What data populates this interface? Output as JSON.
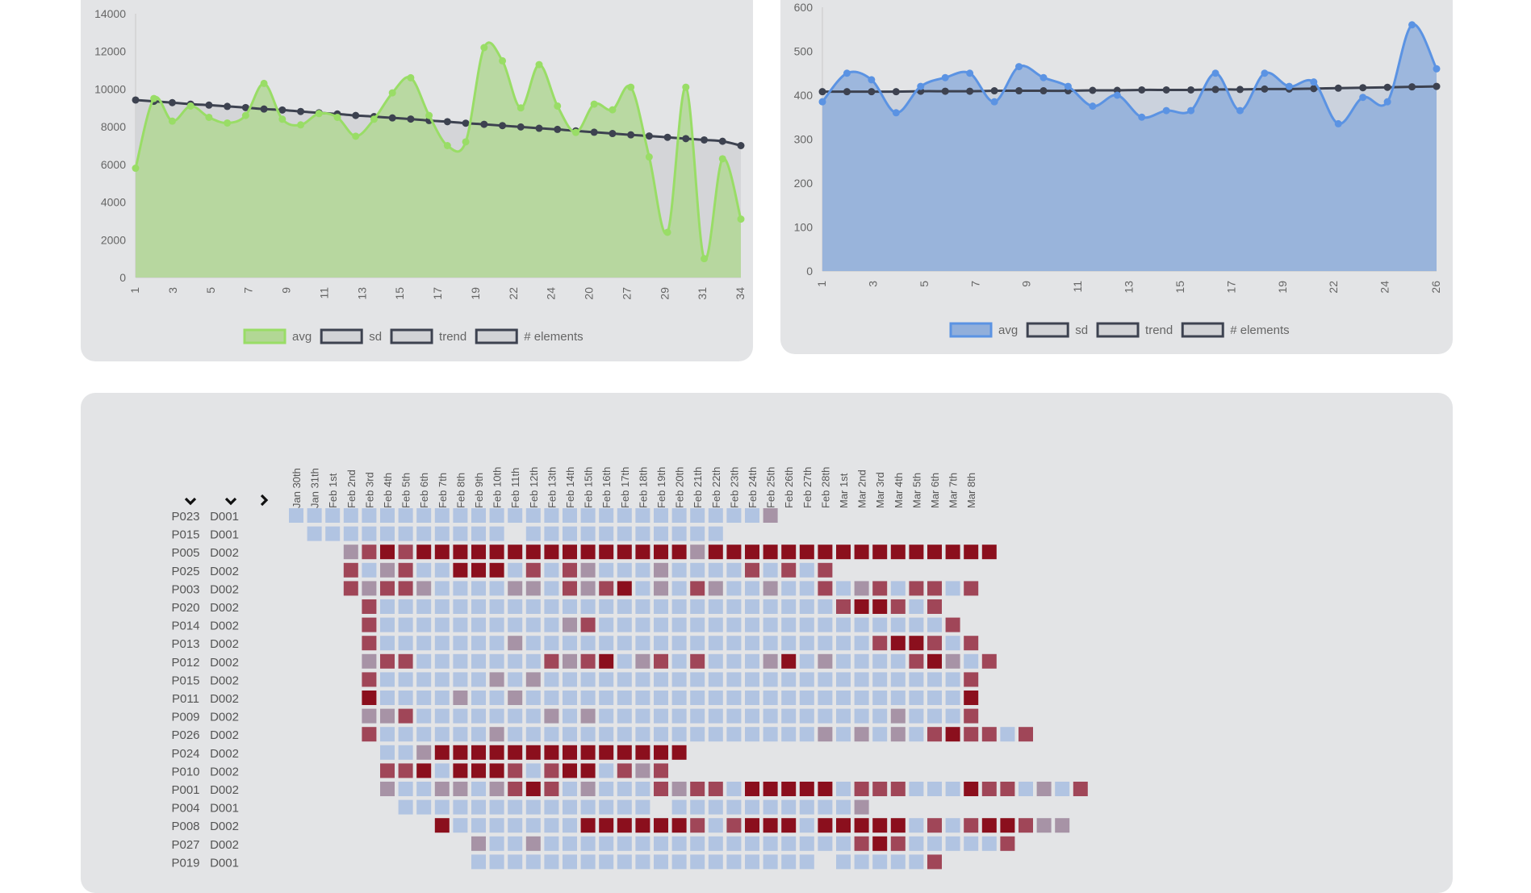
{
  "chart_data": [
    {
      "type": "line",
      "chart": "left",
      "x_ticks": [
        "1",
        "3",
        "5",
        "7",
        "9",
        "11",
        "13",
        "15",
        "17",
        "19",
        "22",
        "24",
        "20",
        "27",
        "29",
        "31",
        "34"
      ],
      "ylim": [
        0,
        14000
      ],
      "y_ticks": [
        "0",
        "2000",
        "4000",
        "6000",
        "8000",
        "10000",
        "12000",
        "14000"
      ],
      "series": [
        {
          "name": "avg",
          "values": [
            5800,
            9500,
            8300,
            9100,
            8500,
            8200,
            8600,
            10300,
            8400,
            8100,
            8700,
            8500,
            7500,
            8400,
            9800,
            10600,
            8600,
            7000,
            7200,
            12200,
            11500,
            9000,
            11300,
            9100,
            7700,
            9200,
            8900,
            10100,
            6400,
            2400,
            10100,
            1000,
            6300,
            3100
          ]
        },
        {
          "name": "sd",
          "values": [
            9420,
            9350,
            9280,
            9200,
            9150,
            9080,
            9020,
            8940,
            8890,
            8810,
            8740,
            8680,
            8600,
            8540,
            8470,
            8410,
            8330,
            8270,
            8190,
            8130,
            8060,
            7990,
            7920,
            7860,
            7780,
            7710,
            7640,
            7570,
            7510,
            7440,
            7370,
            7300,
            7230,
            7000
          ]
        }
      ],
      "legend": [
        "avg",
        "sd",
        "trend",
        "# elements"
      ],
      "colors": {
        "avg_line": "#99dd66",
        "avg_fill": "#b2d795",
        "sd_line": "#3d4250",
        "sd_fill": "#d2d3d6"
      },
      "grid": false
    },
    {
      "type": "line",
      "chart": "right",
      "x_ticks": [
        "1",
        "3",
        "5",
        "7",
        "9",
        "11",
        "13",
        "15",
        "17",
        "19",
        "22",
        "24",
        "26"
      ],
      "ylim": [
        0,
        600
      ],
      "y_ticks": [
        "0",
        "100",
        "200",
        "300",
        "400",
        "500",
        "600"
      ],
      "series": [
        {
          "name": "avg",
          "values": [
            385,
            450,
            435,
            360,
            420,
            440,
            450,
            385,
            465,
            440,
            420,
            375,
            400,
            350,
            365,
            365,
            450,
            365,
            450,
            420,
            430,
            335,
            395,
            385,
            560,
            460
          ]
        },
        {
          "name": "sd",
          "values": [
            408,
            408,
            408,
            408,
            409,
            409,
            409,
            410,
            410,
            410,
            410,
            411,
            411,
            412,
            412,
            412,
            413,
            413,
            414,
            414,
            415,
            416,
            417,
            418,
            419,
            420
          ]
        }
      ],
      "legend": [
        "avg",
        "sd",
        "trend",
        "# elements"
      ],
      "colors": {
        "avg_line": "#5b93e3",
        "avg_fill": "#91afdb",
        "sd_line": "#3d4250",
        "sd_fill": "#c8cfdc"
      },
      "grid": false
    },
    {
      "type": "heatmap",
      "columns": [
        "Jan 30th",
        "Jan 31th",
        "Feb 1st",
        "Feb 2nd",
        "Feb 3rd",
        "Feb 4th",
        "Feb 5th",
        "Feb 6th",
        "Feb 7th",
        "Feb 8th",
        "Feb 9th",
        "Feb 10th",
        "Feb 11th",
        "Feb 12th",
        "Feb 13th",
        "Feb 14th",
        "Feb 15th",
        "Feb 16th",
        "Feb 17th",
        "Feb 18th",
        "Feb 19th",
        "Feb 20th",
        "Feb 21th",
        "Feb 22th",
        "Feb 23th",
        "Feb 24th",
        "Feb 25th",
        "Feb 26th",
        "Feb 27th",
        "Feb 28th",
        "Mar 1st",
        "Mar 2nd",
        "Mar 3rd",
        "Mar 4th",
        "Mar 5th",
        "Mar 6th",
        "Mar 7th",
        "Mar 8th"
      ],
      "rows": [
        {
          "p": "P023",
          "d": "D001",
          "s": 0,
          "c": "..........................a"
        },
        {
          "p": "P015",
          "d": "D001",
          "s": 1,
          "c": "...........-..........."
        },
        {
          "p": "P005",
          "d": "D002",
          "s": 3,
          "c": "aADADDDDDDDDDDDDDDDaDDDDDDDDDDDDDDDD"
        },
        {
          "p": "P025",
          "d": "D002",
          "s": 3,
          "c": "A.aA..DDD.A.Aa...a....A.A.A"
        },
        {
          "p": "P003",
          "d": "D002",
          "s": 3,
          "c": "AaAAa....aa.AaAD.a.Aa..a..A.aA.AA.A"
        },
        {
          "p": "P020",
          "d": "D002",
          "s": 4,
          "c": "A.........................ADDA.A"
        },
        {
          "p": "P014",
          "d": "D002",
          "s": 4,
          "c": "A..........aA...................A"
        },
        {
          "p": "P013",
          "d": "D002",
          "s": 4,
          "c": "A.......a...................ADDA.A"
        },
        {
          "p": "P012",
          "d": "D002",
          "s": 4,
          "c": "aAA.......AaAD.aA.A...aD.a....ADa.A"
        },
        {
          "p": "P015",
          "d": "D002",
          "s": 4,
          "c": "A......a.a.......................A"
        },
        {
          "p": "P011",
          "d": "D002",
          "s": 4,
          "c": "D....a..a........................D"
        },
        {
          "p": "P009",
          "d": "D002",
          "s": 4,
          "c": "aaA.......a.a................a...A"
        },
        {
          "p": "P026",
          "d": "D002",
          "s": 4,
          "c": "A......a.................a.a.a.ADAA.A"
        },
        {
          "p": "P024",
          "d": "D002",
          "s": 5,
          "c": "..aDDDDDDDDDDDDDD"
        },
        {
          "p": "P010",
          "d": "D002",
          "s": 5,
          "c": "AAD.DDDA.ADD.AaA"
        },
        {
          "p": "P001",
          "d": "D002",
          "s": 5,
          "c": "a..aa.aADA.a...AaAA.DDDDD.AAA...DAA.a.A"
        },
        {
          "p": "P004",
          "d": "D001",
          "s": 6,
          "c": "..............-..........a"
        },
        {
          "p": "P008",
          "d": "D002",
          "s": 8,
          "c": "D.......DDDDDDA.ADDD.DDDDD.A.ADDAaa"
        },
        {
          "p": "P027",
          "d": "D002",
          "s": 10,
          "c": "a..a.................ADA.....A"
        },
        {
          "p": "P019",
          "d": "D001",
          "s": 10,
          "c": "...................-.....A"
        }
      ],
      "colors": {
        ".": "#b1c4e2",
        "a": "#a793a6",
        "A": "#a04658",
        "D": "#8b0f1d"
      }
    }
  ],
  "hm_icons": [
    "chevron-down-icon",
    "chevron-down-icon",
    "chevron-right-icon"
  ]
}
